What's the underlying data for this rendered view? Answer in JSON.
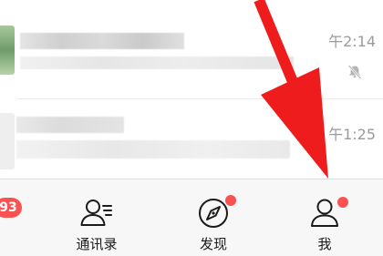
{
  "chats": [
    {
      "time": "午2:14",
      "muted": true
    },
    {
      "time": "午1:25",
      "muted": false
    }
  ],
  "tabbar": {
    "chats_badge": "93",
    "tabs": [
      {
        "label": "通讯录",
        "icon": "contacts-icon"
      },
      {
        "label": "发现",
        "icon": "discover-compass-icon",
        "red_dot": true
      },
      {
        "label": "我",
        "icon": "me-profile-icon",
        "red_dot": true
      }
    ]
  },
  "annotation": {
    "type": "red arrow",
    "points_to": "我",
    "color": "#ee1c1c"
  },
  "colors": {
    "accent_red": "#fa5151",
    "tabbar_bg": "#f7f7f7",
    "time_text": "#9b9b9b"
  }
}
